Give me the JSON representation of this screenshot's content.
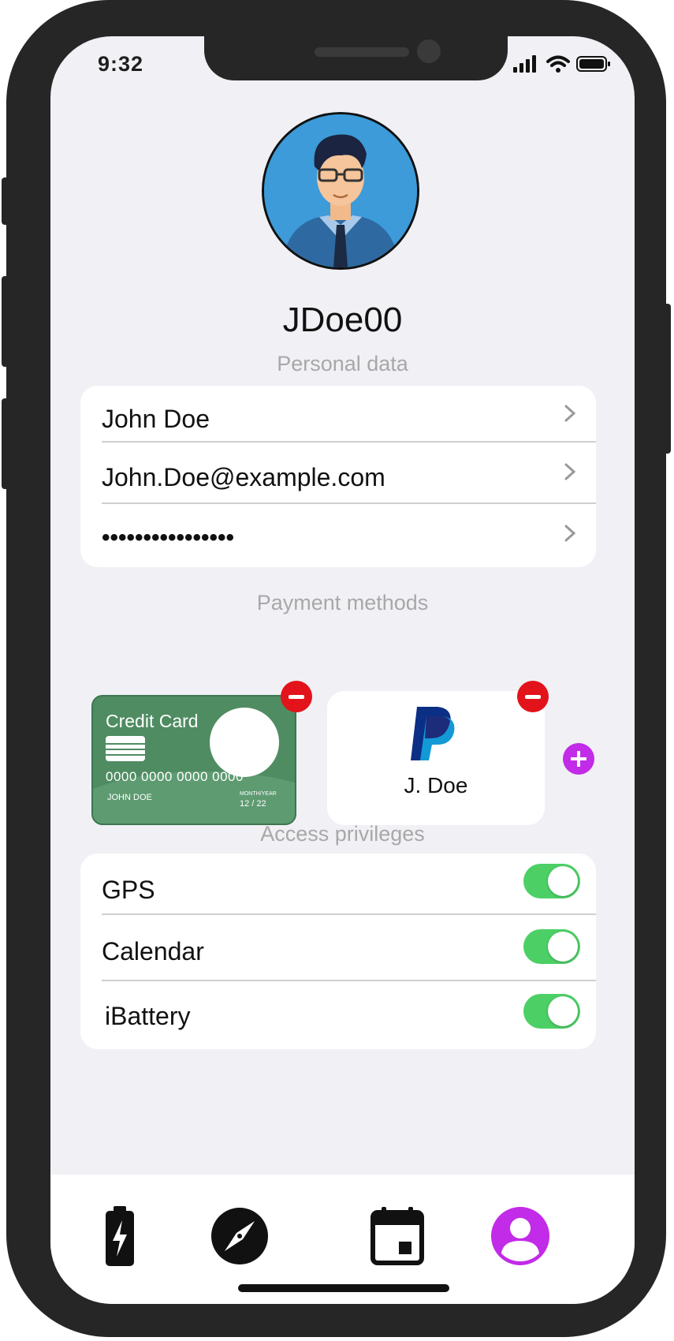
{
  "status_bar": {
    "time": "9:32"
  },
  "profile": {
    "username": "JDoe00"
  },
  "personal_data": {
    "title": "Personal data",
    "rows": [
      {
        "label": "John Doe"
      },
      {
        "label": "John.Doe@example.com"
      },
      {
        "label": "••••••••••••••••"
      }
    ]
  },
  "payment_methods": {
    "title": "Payment methods",
    "credit_card": {
      "title": "Credit Card",
      "number": "0000 0000 0000 0000",
      "holder": "JOHN DOE",
      "expiry_label": "MONTH/YEAR",
      "expiry": "12 / 22"
    },
    "paypal": {
      "name": "J. Doe"
    }
  },
  "access_privileges": {
    "title": "Access privileges",
    "items": [
      {
        "label": "GPS",
        "enabled": true
      },
      {
        "label": "Calendar",
        "enabled": true
      },
      {
        "label": "iBattery",
        "enabled": true
      }
    ]
  },
  "tab_bar": {
    "tabs": [
      {
        "icon": "battery-icon"
      },
      {
        "icon": "compass-icon"
      },
      {
        "icon": "calendar-icon"
      },
      {
        "icon": "profile-icon",
        "active": true
      }
    ]
  },
  "colors": {
    "accent": "#c22be7",
    "toggle_on": "#4cd066",
    "danger": "#e2131a",
    "card_green": "#4f8c62",
    "background": "#f1f0f5"
  }
}
